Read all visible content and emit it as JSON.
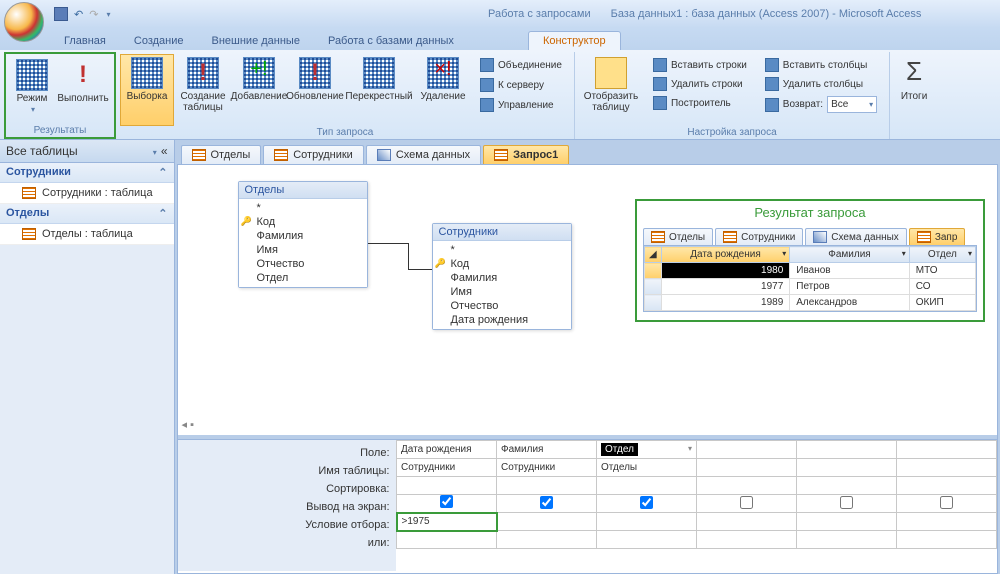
{
  "titlebar": {
    "context_tool": "Работа с запросами",
    "doc_title": "База данных1 : база данных (Access 2007) - Microsoft Access"
  },
  "ribbon_tabs": {
    "home": "Главная",
    "create": "Создание",
    "external": "Внешние данные",
    "dbtools": "Работа с базами данных",
    "design": "Конструктор"
  },
  "ribbon": {
    "results": {
      "label": "Результаты",
      "view": "Режим",
      "run": "Выполнить"
    },
    "qtype": {
      "label": "Тип запроса",
      "select": "Выборка",
      "maketable": "Создание таблицы",
      "append": "Добавление",
      "update": "Обновление",
      "crosstab": "Перекрестный",
      "delete": "Удаление",
      "union": "Объединение",
      "passthrough": "К серверу",
      "datadef": "Управление"
    },
    "showtable": {
      "label": "Отобразить таблицу",
      "btn": "Отобразить таблицу"
    },
    "setup": {
      "label": "Настройка запроса",
      "insrows": "Вставить строки",
      "delrows": "Удалить строки",
      "builder": "Построитель",
      "inscols": "Вставить столбцы",
      "delcols": "Удалить столбцы",
      "return": "Возврат:",
      "return_val": "Все"
    },
    "totals": {
      "label": "",
      "btn": "Итоги"
    }
  },
  "navpane": {
    "header": "Все таблицы",
    "grp1": "Сотрудники",
    "item1": "Сотрудники : таблица",
    "grp2": "Отделы",
    "item2": "Отделы : таблица"
  },
  "doctabs": {
    "t1": "Отделы",
    "t2": "Сотрудники",
    "t3": "Схема данных",
    "t4": "Запрос1"
  },
  "diagram": {
    "departments": {
      "title": "Отделы",
      "star": "*",
      "f1": "Код",
      "f2": "Фамилия",
      "f3": "Имя",
      "f4": "Отчество",
      "f5": "Отдел"
    },
    "employees": {
      "title": "Сотрудники",
      "star": "*",
      "f1": "Код",
      "f2": "Фамилия",
      "f3": "Имя",
      "f4": "Отчество",
      "f5": "Дата рождения"
    }
  },
  "result": {
    "title": "Результат запроса",
    "tabs": {
      "t1": "Отделы",
      "t2": "Сотрудники",
      "t3": "Схема данных",
      "t4": "Запр"
    },
    "cols": {
      "c1": "Дата рождения",
      "c2": "Фамилия",
      "c3": "Отдел"
    },
    "rows": [
      {
        "c1": "1980",
        "c2": "Иванов",
        "c3": "МТО"
      },
      {
        "c1": "1977",
        "c2": "Петров",
        "c3": "СО"
      },
      {
        "c1": "1989",
        "c2": "Александров",
        "c3": "ОКИП"
      }
    ]
  },
  "qbe": {
    "labels": {
      "field": "Поле:",
      "table": "Имя таблицы:",
      "sort": "Сортировка:",
      "show": "Вывод на экран:",
      "criteria": "Условие отбора:",
      "or": "или:"
    },
    "cols": [
      {
        "field": "Дата рождения",
        "table": "Сотрудники",
        "show": true,
        "criteria": ">1975"
      },
      {
        "field": "Фамилия",
        "table": "Сотрудники",
        "show": true,
        "criteria": ""
      },
      {
        "field": "Отдел",
        "table": "Отделы",
        "show": true,
        "criteria": ""
      }
    ]
  }
}
